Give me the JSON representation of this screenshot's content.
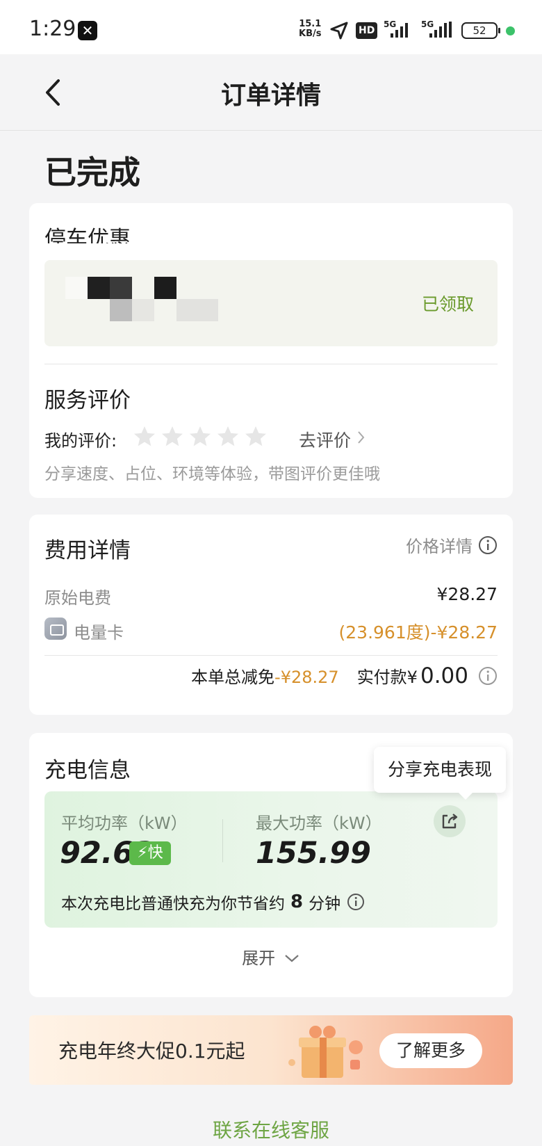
{
  "status_bar": {
    "time": "1:29",
    "app_icon": "✕",
    "net_speed_value": "15.1",
    "net_speed_unit": "KB/s",
    "hd_label": "HD",
    "sim1_tag": "5G",
    "sim2_tag": "5G",
    "battery": "52"
  },
  "nav": {
    "title": "订单详情"
  },
  "order_status": "已完成",
  "parking": {
    "title": "停车优惠",
    "coupon_status": "已领取"
  },
  "review": {
    "title": "服务评价",
    "my_rating_label": "我的评价:",
    "stars_filled": 0,
    "stars_total": 5,
    "go_rate": "去评价",
    "hint": "分享速度、占位、环境等体验，带图评价更佳哦"
  },
  "fee": {
    "title": "费用详情",
    "price_detail_link": "价格详情",
    "rows": [
      {
        "label": "原始电费",
        "value": "¥28.27"
      },
      {
        "label": "电量卡",
        "value": "(23.961度)-¥28.27"
      }
    ],
    "total_discount_label": "本单总减免",
    "total_discount_value": "-¥28.27",
    "paid_label": "实付款¥",
    "paid_value": "0.00"
  },
  "charge": {
    "title": "充电信息",
    "tooltip": "分享充电表现",
    "avg_power_label": "平均功率（kW）",
    "avg_power_value": "92.63",
    "fast_badge": "⚡快",
    "max_power_label": "最大功率（kW）",
    "max_power_value": "155.99",
    "note_prefix": "本次充电比普通快充为你节省约",
    "note_minutes": "8",
    "note_suffix": "分钟",
    "expand_label": "展开"
  },
  "promo": {
    "text": "充电年终大促0.1元起",
    "button": "了解更多"
  },
  "contact": "联系在线客服",
  "colors": {
    "brand_green": "#6ea544",
    "accent_orange": "#d6902b",
    "fast_badge_green": "#5cb94a",
    "page_bg": "#f4f4f5"
  }
}
